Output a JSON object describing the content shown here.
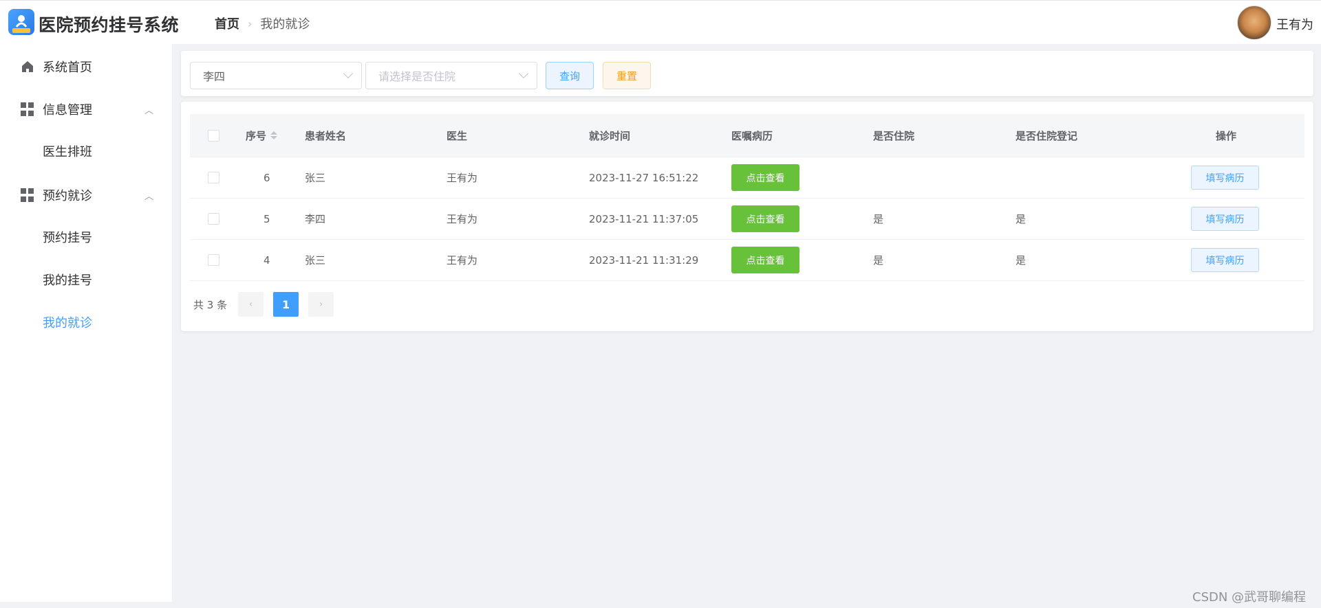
{
  "app": {
    "title": "医院预约挂号系统"
  },
  "breadcrumb": {
    "home": "首页",
    "current": "我的就诊"
  },
  "user": {
    "name": "王有为"
  },
  "sidebar": {
    "items": [
      {
        "label": "系统首页",
        "icon": "home-icon"
      },
      {
        "label": "信息管理",
        "icon": "grid-icon",
        "chevron": "^"
      },
      {
        "label": "医生排班"
      },
      {
        "label": "预约就诊",
        "icon": "grid-icon",
        "chevron": "^"
      },
      {
        "label": "预约挂号"
      },
      {
        "label": "我的挂号"
      },
      {
        "label": "我的就诊",
        "active": true
      }
    ]
  },
  "filters": {
    "patient_value": "李四",
    "hospitalized_placeholder": "请选择是否住院",
    "query_label": "查询",
    "reset_label": "重置"
  },
  "table": {
    "headers": {
      "index": "序号",
      "patient": "患者姓名",
      "doctor": "医生",
      "time": "就诊时间",
      "record": "医嘱病历",
      "hospitalized": "是否住院",
      "registered": "是否住院登记",
      "action": "操作"
    },
    "rows": [
      {
        "index": "6",
        "patient": "张三",
        "doctor": "王有为",
        "time": "2023-11-27 16:51:22",
        "view": "点击查看",
        "hospitalized": "",
        "registered": "",
        "fill": "填写病历"
      },
      {
        "index": "5",
        "patient": "李四",
        "doctor": "王有为",
        "time": "2023-11-21 11:37:05",
        "view": "点击查看",
        "hospitalized": "是",
        "registered": "是",
        "fill": "填写病历"
      },
      {
        "index": "4",
        "patient": "张三",
        "doctor": "王有为",
        "time": "2023-11-21 11:31:29",
        "view": "点击查看",
        "hospitalized": "是",
        "registered": "是",
        "fill": "填写病历"
      }
    ]
  },
  "pagination": {
    "total": "共 3 条",
    "current_page": "1",
    "prev": "‹",
    "next": "›"
  },
  "watermark": "CSDN @武哥聊编程",
  "colors": {
    "primary": "#409eff",
    "success": "#67c23a",
    "warning": "#e6a23c"
  }
}
